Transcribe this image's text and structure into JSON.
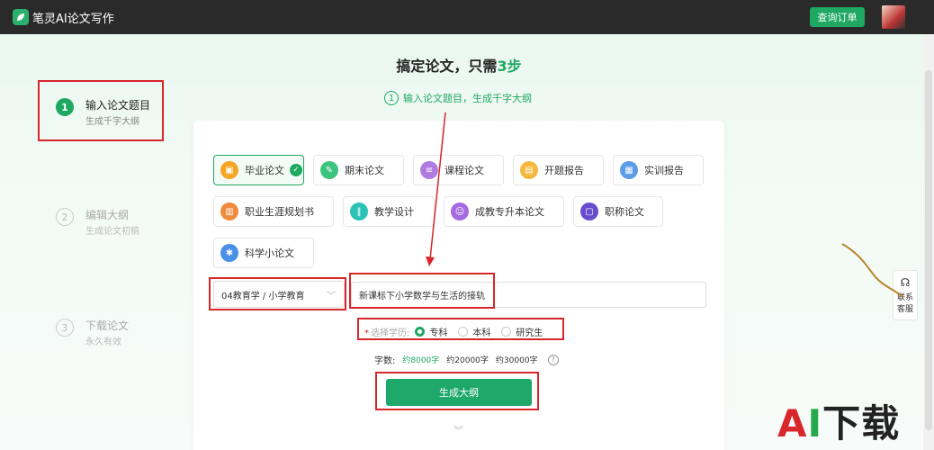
{
  "app": {
    "name": "笔灵AI论文写作",
    "order_button": "查询订单"
  },
  "headline": {
    "prefix": "搞定论文，只需",
    "accent": "3步"
  },
  "current_step": {
    "num": "1",
    "text": "输入论文题目，生成千字大纲"
  },
  "steps": [
    {
      "num": "1",
      "title": "输入论文题目",
      "sub": "生成千字大纲",
      "active": true
    },
    {
      "num": "2",
      "title": "编辑大纲",
      "sub": "生成论文初稿",
      "active": false
    },
    {
      "num": "3",
      "title": "下载论文",
      "sub": "永久有效",
      "active": false
    }
  ],
  "paper_types": [
    {
      "label": "毕业论文",
      "color": "#f5a623",
      "selected": true
    },
    {
      "label": "期末论文",
      "color": "#3cc37e",
      "selected": false
    },
    {
      "label": "课程论文",
      "color": "#b07be0",
      "selected": false
    },
    {
      "label": "开题报告",
      "color": "#f5b83d",
      "selected": false
    },
    {
      "label": "实训报告",
      "color": "#5b9be8",
      "selected": false
    },
    {
      "label": "职业生涯规划书",
      "color": "#f08a3c",
      "selected": false
    },
    {
      "label": "教学设计",
      "color": "#2cc2b5",
      "selected": false
    },
    {
      "label": "成教专升本论文",
      "color": "#a66be0",
      "selected": false
    },
    {
      "label": "职称论文",
      "color": "#6a4ccf",
      "selected": false
    },
    {
      "label": "科学小论文",
      "color": "#4a8fe8",
      "selected": false
    }
  ],
  "subject_select": {
    "value": "04教育学 / 小学教育"
  },
  "topic_input": {
    "value": "新课标下小学数学与生活的接轨"
  },
  "education": {
    "label": "选择学历:",
    "options": [
      {
        "label": "专科",
        "selected": true
      },
      {
        "label": "本科",
        "selected": false
      },
      {
        "label": "研究生",
        "selected": false
      }
    ]
  },
  "word_count": {
    "label": "字数:",
    "options": [
      {
        "label": "约8000字",
        "selected": true
      },
      {
        "label": "约20000字",
        "selected": false
      },
      {
        "label": "约30000字",
        "selected": false
      }
    ],
    "help": "?"
  },
  "generate_button": "生成大纲",
  "service": {
    "line1": "联系",
    "line2": "客服"
  },
  "watermark": {
    "a": "A",
    "i": "I",
    "rest": "下载"
  },
  "colors": {
    "accent": "#1fa862",
    "highlight": "#d8262b",
    "topbar": "#2a2a2a"
  }
}
